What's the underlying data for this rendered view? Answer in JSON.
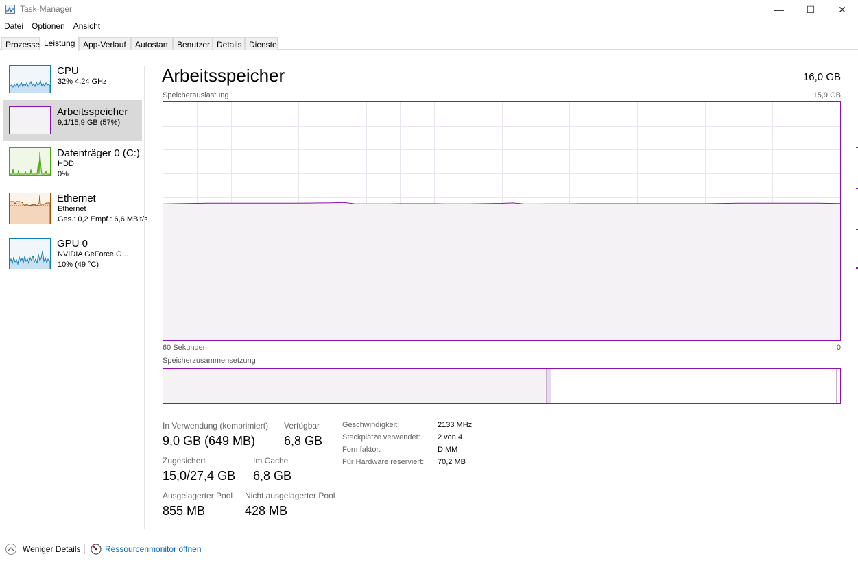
{
  "window": {
    "title": "Task-Manager",
    "minimize_glyph": "—",
    "maximize_glyph": "☐",
    "close_glyph": "✕"
  },
  "menu": [
    "Datei",
    "Optionen",
    "Ansicht"
  ],
  "tabs": [
    {
      "label": "Prozesse",
      "active": false
    },
    {
      "label": "Leistung",
      "active": true
    },
    {
      "label": "App-Verlauf",
      "active": false
    },
    {
      "label": "Autostart",
      "active": false
    },
    {
      "label": "Benutzer",
      "active": false
    },
    {
      "label": "Details",
      "active": false
    },
    {
      "label": "Dienste",
      "active": false
    }
  ],
  "sidebar": {
    "items": [
      {
        "title": "CPU",
        "line1": "32% 4,24 GHz",
        "line2": "",
        "color": "#117dbb",
        "fill": "#f1f6fa"
      },
      {
        "title": "Arbeitsspeicher",
        "line1": "9,1/15,9 GB (57%)",
        "line2": "",
        "color": "#8b12ae",
        "fill": "#f4f2f4"
      },
      {
        "title": "Datenträger 0 (C:)",
        "line1": "HDD",
        "line2": "0%",
        "color": "#4da60c",
        "fill": "#eff7e8"
      },
      {
        "title": "Ethernet",
        "line1": "Ethernet",
        "line2": "Ges.: 0,2  Empf.: 6,6 MBit/s",
        "color": "#a74f01",
        "fill": "#fcf3eb"
      },
      {
        "title": "GPU 0",
        "line1": "NVIDIA GeForce G...",
        "line2": "10% (49 °C)",
        "color": "#117dbb",
        "fill": "#f1f6fa"
      }
    ]
  },
  "main": {
    "title": "Arbeitsspeicher",
    "total": "16,0 GB",
    "usage_label": "Speicherauslastung",
    "usage_max": "15,9 GB",
    "time_left": "60 Sekunden",
    "time_right": "0",
    "composition_label": "Speicherzusammensetzung",
    "line_color": "#8b12ae",
    "usage_history_gb": [
      9.1,
      9.12,
      9.13,
      9.14,
      9.15,
      9.15,
      9.15,
      9.15,
      9.15,
      9.15,
      9.15,
      9.15,
      9.15,
      9.16,
      9.17,
      9.18,
      9.2,
      9.11,
      9.11,
      9.11,
      9.11,
      9.12,
      9.12,
      9.12,
      9.12,
      9.11,
      9.11,
      9.11,
      9.12,
      9.13,
      9.14,
      9.17,
      9.1,
      9.1,
      9.11,
      9.11,
      9.11,
      9.12,
      9.12,
      9.12,
      9.12,
      9.12,
      9.12,
      9.12,
      9.12,
      9.12,
      9.12,
      9.12,
      9.12,
      9.13,
      9.14,
      9.15,
      9.15,
      9.15,
      9.15,
      9.15,
      9.15,
      9.15,
      9.15,
      9.14,
      9.13
    ],
    "composition": {
      "in_use_fraction": 0.565,
      "modified_fraction": 0.008,
      "standby_fraction": 0.42
    },
    "stats": {
      "in_use_label": "In Verwendung (komprimiert)",
      "in_use_value": "9,0 GB (649 MB)",
      "available_label": "Verfügbar",
      "available_value": "6,8 GB",
      "committed_label": "Zugesichert",
      "committed_value": "15,0/27,4 GB",
      "cached_label": "Im Cache",
      "cached_value": "6,8 GB",
      "paged_label": "Ausgelagerter Pool",
      "paged_value": "855 MB",
      "nonpaged_label": "Nicht ausgelagerter Pool",
      "nonpaged_value": "428 MB"
    },
    "props": [
      {
        "label": "Geschwindigkeit:",
        "value": "2133 MHz"
      },
      {
        "label": "Steckplätze verwendet:",
        "value": "2 von 4"
      },
      {
        "label": "Formfaktor:",
        "value": "DIMM"
      },
      {
        "label": "Für Hardware reserviert:",
        "value": "70,2 MB"
      }
    ]
  },
  "footer": {
    "fewer_details": "Weniger Details",
    "resource_monitor": "Ressourcenmonitor öffnen"
  }
}
